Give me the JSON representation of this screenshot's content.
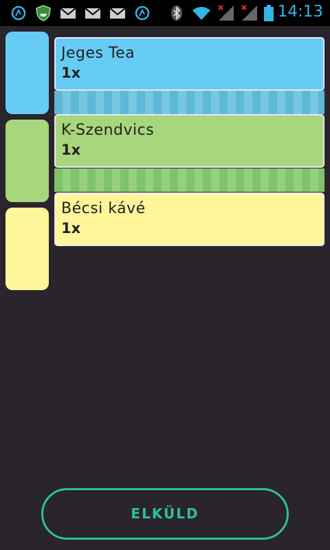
{
  "status_bar": {
    "time": "14:13",
    "icons": [
      "app-circle-icon",
      "shield-app-icon",
      "mail-icon",
      "mail-icon",
      "mail-icon",
      "app-circle-icon",
      "bluetooth-icon",
      "wifi-icon",
      "signal-no-service-icon",
      "signal-no-service-icon",
      "battery-icon"
    ]
  },
  "colors": {
    "background": "#2a242d",
    "blue": "#66ccf5",
    "green": "#a8d67c",
    "yellow": "#fff69a",
    "accent": "#2fbf9f"
  },
  "categories": [
    {
      "name": "blue"
    },
    {
      "name": "green"
    },
    {
      "name": "yellow"
    }
  ],
  "order_items": [
    {
      "name": "Jeges Tea",
      "qty": "1x"
    },
    {
      "name": "K-Szendvics",
      "qty": "1x"
    },
    {
      "name": "Bécsi kávé",
      "qty": "1x"
    }
  ],
  "send_button": {
    "label": "ELKÜLD"
  }
}
